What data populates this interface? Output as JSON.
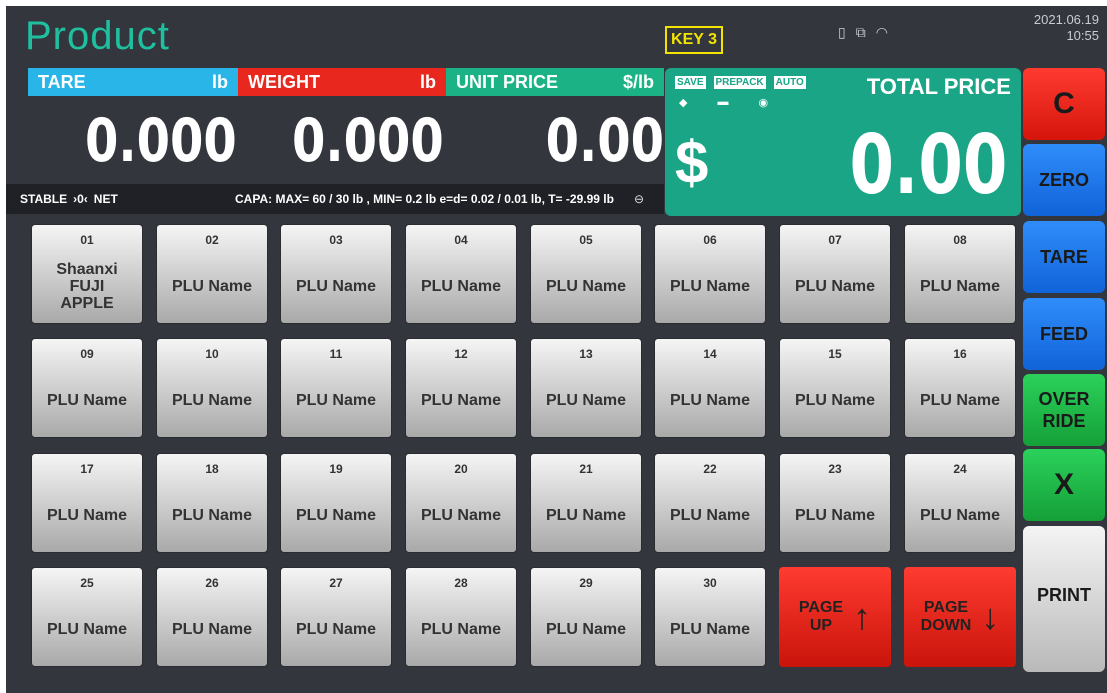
{
  "header": {
    "title": "Product",
    "key_badge": "KEY 3",
    "date": "2021.06.19",
    "time": "10:55",
    "status_icons": [
      "battery-icon",
      "network-icon",
      "wifi-icon"
    ]
  },
  "labels": {
    "tare": "TARE",
    "tare_unit": "lb",
    "weight": "WEIGHT",
    "weight_unit": "lb",
    "unit_price": "UNIT PRICE",
    "unit_price_unit": "$/lb"
  },
  "values": {
    "tare": "0.000",
    "weight": "0.000",
    "unit_price": "0.00"
  },
  "status_bar": {
    "stable": "STABLE",
    "zero_symbol": "›0‹",
    "net": "NET",
    "capacity": "CAPA: MAX= 60 / 30 lb , MIN= 0.2 lb e=d= 0.02 / 0.01 lb, T= -29.99 lb"
  },
  "total": {
    "tags": [
      "SAVE",
      "PREPACK",
      "AUTO"
    ],
    "label": "TOTAL PRICE",
    "currency": "$",
    "value": "0.00"
  },
  "side_buttons": {
    "c": "C",
    "zero": "ZERO",
    "tare": "TARE",
    "feed": "FEED",
    "override": "OVER\nRIDE",
    "x": "X",
    "print": "PRINT"
  },
  "plu_items": [
    {
      "num": "01",
      "name": "Shaanxi\nFUJI\nAPPLE"
    },
    {
      "num": "02",
      "name": "PLU Name"
    },
    {
      "num": "03",
      "name": "PLU Name"
    },
    {
      "num": "04",
      "name": "PLU Name"
    },
    {
      "num": "05",
      "name": "PLU Name"
    },
    {
      "num": "06",
      "name": "PLU Name"
    },
    {
      "num": "07",
      "name": "PLU Name"
    },
    {
      "num": "08",
      "name": "PLU Name"
    },
    {
      "num": "09",
      "name": "PLU Name"
    },
    {
      "num": "10",
      "name": "PLU Name"
    },
    {
      "num": "11",
      "name": "PLU Name"
    },
    {
      "num": "12",
      "name": "PLU Name"
    },
    {
      "num": "13",
      "name": "PLU Name"
    },
    {
      "num": "14",
      "name": "PLU Name"
    },
    {
      "num": "15",
      "name": "PLU Name"
    },
    {
      "num": "16",
      "name": "PLU Name"
    },
    {
      "num": "17",
      "name": "PLU Name"
    },
    {
      "num": "18",
      "name": "PLU Name"
    },
    {
      "num": "19",
      "name": "PLU Name"
    },
    {
      "num": "20",
      "name": "PLU Name"
    },
    {
      "num": "21",
      "name": "PLU Name"
    },
    {
      "num": "22",
      "name": "PLU Name"
    },
    {
      "num": "23",
      "name": "PLU Name"
    },
    {
      "num": "24",
      "name": "PLU Name"
    },
    {
      "num": "25",
      "name": "PLU Name"
    },
    {
      "num": "26",
      "name": "PLU Name"
    },
    {
      "num": "27",
      "name": "PLU Name"
    },
    {
      "num": "28",
      "name": "PLU Name"
    },
    {
      "num": "29",
      "name": "PLU Name"
    },
    {
      "num": "30",
      "name": "PLU Name"
    }
  ],
  "paging": {
    "page_up": "PAGE\nUP",
    "page_down": "PAGE\nDOWN"
  },
  "colors": {
    "background": "#33363d",
    "title": "#1fc0a0",
    "tare": "#29b5e8",
    "weight": "#e8281e",
    "unit_price": "#1bb385",
    "total_panel": "#1aa587",
    "red_button": "#e8281e",
    "blue_button": "#1f78e8",
    "green_button": "#20b848",
    "key_badge": "#f3e300"
  }
}
